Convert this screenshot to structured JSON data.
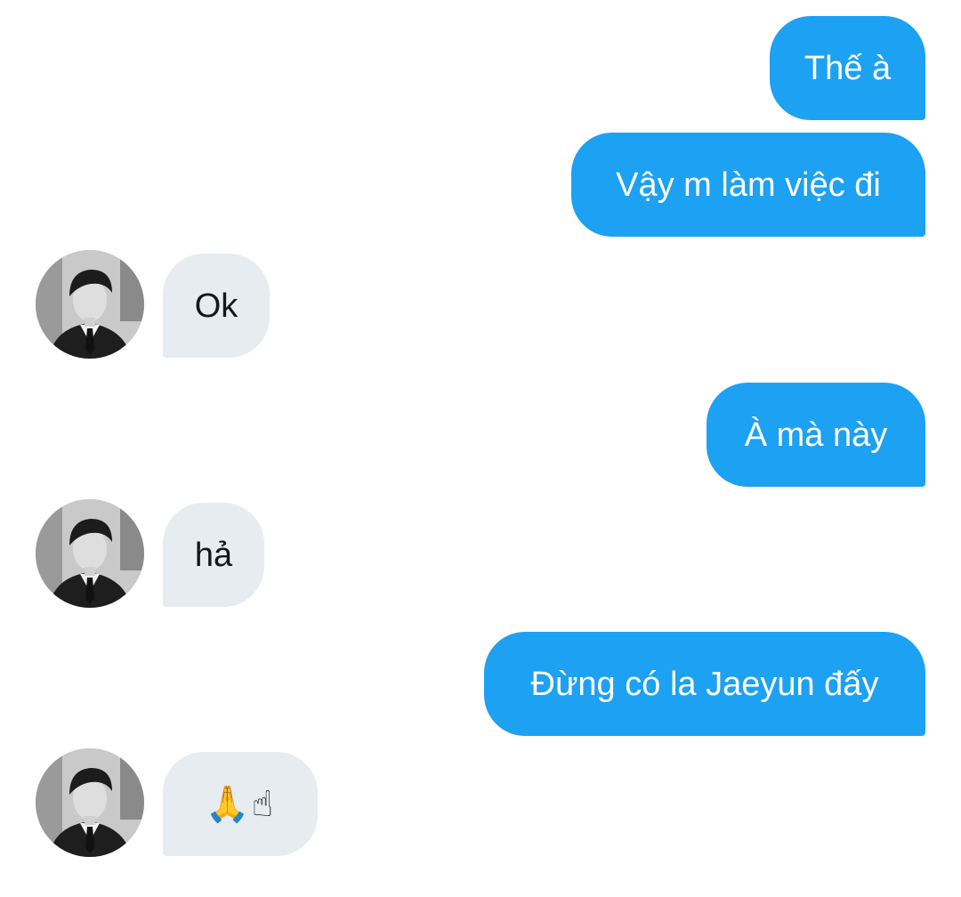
{
  "messages": [
    {
      "direction": "outgoing",
      "text": "Thế à"
    },
    {
      "direction": "outgoing",
      "text": "Vậy m làm việc đi"
    },
    {
      "direction": "incoming",
      "text": "Ok"
    },
    {
      "direction": "outgoing",
      "text": "À mà này"
    },
    {
      "direction": "incoming",
      "text": "hả"
    },
    {
      "direction": "outgoing",
      "text": "Đừng có la Jaeyun đấy"
    },
    {
      "direction": "incoming",
      "text": "🙏☝"
    }
  ],
  "colors": {
    "outgoing_bubble": "#1da1f2",
    "incoming_bubble": "#e6ecf0",
    "outgoing_text": "#ffffff",
    "incoming_text": "#14171a"
  },
  "avatar": {
    "icon": "user-avatar-photo"
  }
}
